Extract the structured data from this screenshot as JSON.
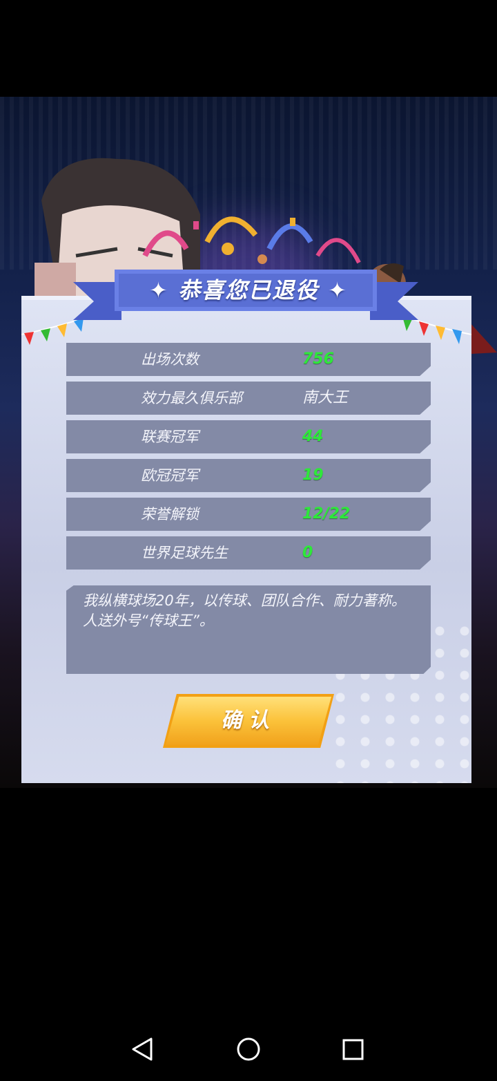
{
  "dialog": {
    "title": "恭喜您已退役",
    "stats": [
      {
        "label": "出场次数",
        "value": "756"
      },
      {
        "label": "效力最久俱乐部",
        "value": "南大王"
      },
      {
        "label": "联赛冠军",
        "value": "44"
      },
      {
        "label": "欧冠冠军",
        "value": "19"
      },
      {
        "label": "荣誉解锁",
        "value": "12/22"
      },
      {
        "label": "世界足球先生",
        "value": "0"
      }
    ],
    "bio": "我纵横球场20年，以传球、团队合作、耐力著称。人送外号“传球王”。",
    "confirm_label": "确认"
  },
  "colors": {
    "panel": "#d6dbee",
    "row_bg": "#838aa6",
    "value_green": "#2ee83a",
    "banner_blue": "#5a6fd4",
    "button_gold": "#fbc23a"
  },
  "icons": {
    "back": "triangle-back-icon",
    "home": "circle-home-icon",
    "recents": "square-recents-icon"
  }
}
